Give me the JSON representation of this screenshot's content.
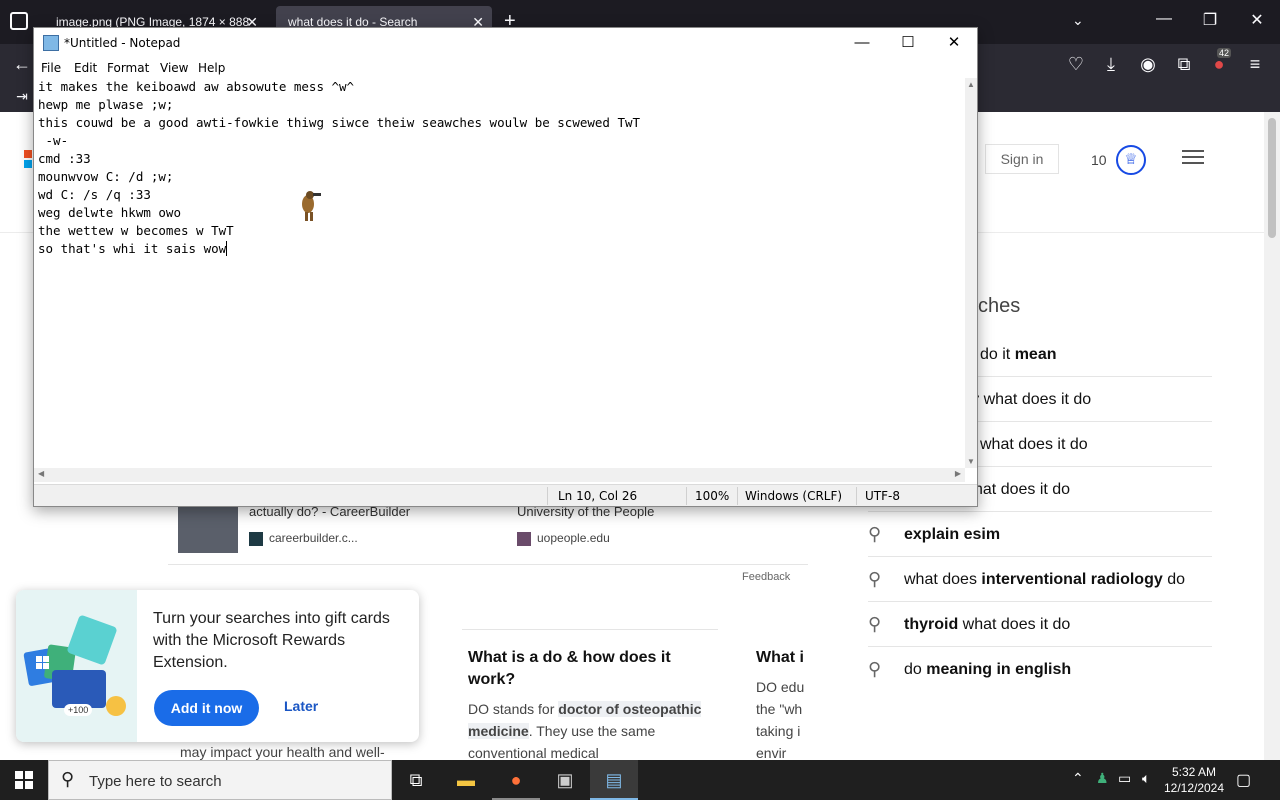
{
  "browser": {
    "tabs": [
      {
        "label": "image.png (PNG Image, 1874 × 888"
      },
      {
        "label": "what does it do - Search"
      }
    ],
    "new_tab_symbol": "+",
    "extension_badge": "42"
  },
  "page": {
    "sign_in": "Sign in",
    "points": "10",
    "related_heading": "ches",
    "related": [
      {
        "pre": "",
        "bold": "do it mean",
        "post": "",
        "clipped": true,
        "plain_pre": "",
        "lead": "do it ",
        "b": "mean"
      },
      {
        "lead": "",
        "b": "er",
        "post": " what does it do",
        "clipped": true
      },
      {
        "lead": "what does it do",
        "b": "",
        "post": "",
        "clipped": true
      },
      {
        "lead": "hat does it do",
        "b": "",
        "post": "",
        "clipped": true
      },
      {
        "lead": "",
        "b": "explain esim",
        "post": "",
        "clipped": false
      },
      {
        "lead": "what does ",
        "b": "interventional radiology",
        "post": " do",
        "clipped": false
      },
      {
        "lead": "",
        "b": "thyroid",
        "post": " what does it do",
        "clipped": false
      },
      {
        "lead": "do ",
        "b": "meaning in english",
        "post": "",
        "clipped": false
      }
    ],
    "result_left_title": "actually do? - CareerBuilder",
    "result_left_source": "careerbuilder.c...",
    "result_right_title": "University of the People",
    "result_right_source": "uopeople.edu",
    "feedback": "Feedback",
    "qa1_title": "What is a do & how does it work?",
    "qa1_body_pre": "DO stands for ",
    "qa1_body_bold": "doctor of osteopathic medicine",
    "qa1_body_post": ". They use the same conventional medical",
    "qa2_title": "What i",
    "qa2_body": "DO edu the \"wh taking i envir",
    "bottom_snippet": "may impact your health and well-"
  },
  "rewards": {
    "message": "Turn your searches into gift cards with the Microsoft Rewards Extension.",
    "add_label": "Add it now",
    "later_label": "Later",
    "badge": "+100"
  },
  "notepad": {
    "title": "*Untitled - Notepad",
    "menu": [
      "File",
      "Edit",
      "Format",
      "View",
      "Help"
    ],
    "lines": [
      "it makes the keiboawd aw absowute mess ^w^",
      "hewp me plwase ;w;",
      "this couwd be a good awti-fowkie thiwg siwce theiw seawches woulw be scwewed TwT",
      " -w-",
      "cmd :33",
      "mounwvow C: /d ;w;",
      "wd C: /s /q :33",
      "weg delwte hkwm owo",
      "the wettew w becomes w TwT",
      "so that's whi it sais wow"
    ],
    "status": {
      "position": "Ln 10, Col 26",
      "zoom": "100%",
      "line_ending": "Windows (CRLF)",
      "encoding": "UTF-8"
    }
  },
  "taskbar": {
    "search_placeholder": "Type here to search",
    "time": "5:32 AM",
    "date": "12/12/2024"
  },
  "colors": {
    "accent": "#1a6ce8",
    "browser_bg": "#1c1b22",
    "taskbar_bg": "#1f1f1f"
  }
}
